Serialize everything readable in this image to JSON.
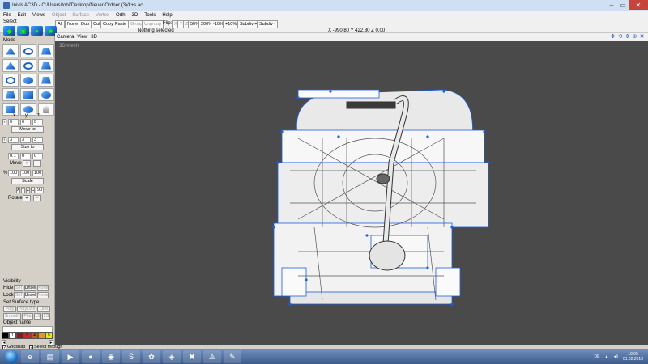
{
  "window": {
    "title": "Inivis AC3D - C:/Users/tobi/Desktop/Neuer Ordner (3)/k+s.ac",
    "min": "–",
    "max": "▭",
    "close": "✕"
  },
  "menus": [
    "File",
    "Edit",
    "Views",
    "Object",
    "Surface",
    "Vertex",
    "Orth",
    "3D",
    "Tools",
    "Help"
  ],
  "toolbar": {
    "select_label": "Select",
    "all": "All",
    "none": "None",
    "dup": "Dup",
    "cut": "Cut",
    "copy": "Copy",
    "paste": "Paste",
    "group": "Group",
    "ungroup": "Ungroup",
    "status": "Nothing selected",
    "flip_label": "Flip:",
    "flip_x": "X",
    "flip_y": "Y",
    "flip_z": "Z",
    "zoom50": "50%",
    "zoom200": "200%",
    "minus10": "-10%",
    "plus10": "+10%",
    "subdiv_plus": "Subdiv +",
    "subdiv_minus": "Subdiv -",
    "coords": "X -990.80 Y 422.80 Z 0.00"
  },
  "left_panel": {
    "mode_label": "Mode",
    "mode_tools": [
      "move-tool-icon",
      "rotate-tool-icon",
      "extrude-tool-icon",
      "poly-tool-icon",
      "line-tool-icon",
      "mesh-tool-icon",
      "ellipse-tool-icon",
      "disc-tool-icon",
      "box-tool-icon",
      "cylinder-tool-icon",
      "cube-tool-icon",
      "sphere-tool-icon",
      "cone-tool-icon",
      "globe-tool-icon",
      "light-tool-icon"
    ],
    "x_label": "x",
    "y_label": "y",
    "z_label": "z",
    "move_vals": [
      "0",
      "0",
      "0"
    ],
    "move_to": "Move to",
    "size_vals": [
      "3",
      "3",
      "3"
    ],
    "size_to": "Size to",
    "move_step": [
      "0.1",
      "0",
      "0"
    ],
    "move_label": "Move",
    "plus": "+",
    "minus": "-",
    "scale_pct": "%",
    "scale_vals": [
      "100",
      "100",
      "100"
    ],
    "scale": "Scale",
    "rot_axes": [
      "X",
      "Y",
      "Z",
      "C"
    ],
    "rot_deg": "90",
    "rotate_label": "Rotate",
    "visibility_label": "Visibility",
    "hide_label": "Hide",
    "lock_label": "Lock",
    "sel": "Sel",
    "unsel": "Unsel",
    "none": "None",
    "surface_label": "Set Surface type",
    "poly": "Poly",
    "polyline": "PolyLine",
    "line": "Line",
    "smooth": "Smooth",
    "flat": "Flat",
    "one_sided": "1S",
    "two_sided": "2S",
    "object_name_label": "Object name",
    "palette": [
      {
        "color": "#000000",
        "text": ""
      },
      {
        "color": "#ffffff",
        "text": "1"
      },
      {
        "color": "#8a1a1a",
        "text": ""
      },
      {
        "color": "#e01d1d",
        "text": "3"
      },
      {
        "color": "#c05a18",
        "text": "4"
      },
      {
        "color": "#e59a14",
        "text": ""
      },
      {
        "color": "#e8e800",
        "text": "5"
      },
      {
        "color": "#29a829",
        "text": ""
      }
    ]
  },
  "viewport": {
    "head_items": [
      "Camera",
      "View",
      "3D"
    ],
    "view_label": "3D mesh",
    "controls": [
      "✥",
      "⟲",
      "⇕",
      "⊕",
      "✕"
    ],
    "bg": "#4a4a4a",
    "wire": "#1c5ee0"
  },
  "statusbar": {
    "grid": "Gridsnap",
    "through": "Select through",
    "grid_checked": "✓",
    "through_checked": "✓"
  },
  "taskbar": {
    "apps": [
      "explorer-icon",
      "internet-explorer-icon",
      "folder-icon",
      "media-player-icon",
      "firefox-icon",
      "chrome-icon",
      "sketchup-icon",
      "paint-icon",
      "app-icon",
      "ac3d-icon",
      "wireframe-icon",
      "editor-icon"
    ],
    "glyphs": [
      "",
      "e",
      "▤",
      "▶",
      "●",
      "◉",
      "S",
      "✿",
      "◈",
      "✖",
      "⟁",
      "✎"
    ],
    "lang": "DE",
    "time": "18:05",
    "date": "01.02.2013"
  }
}
